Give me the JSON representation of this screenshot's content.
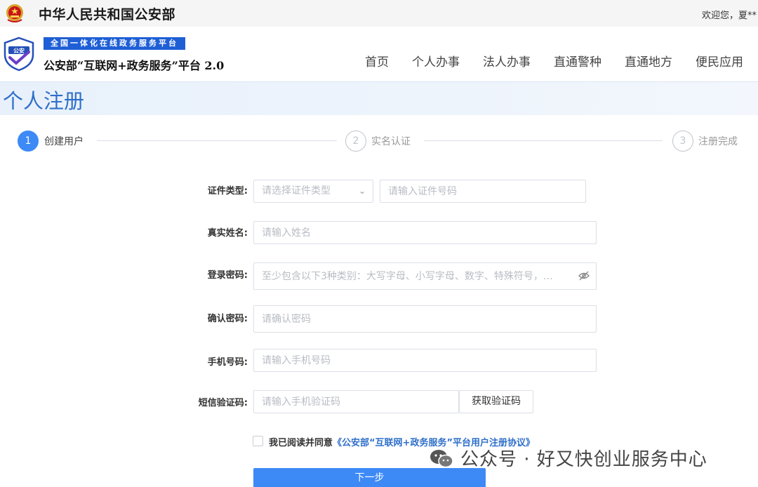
{
  "topbar": {
    "gov_title": "中华人民共和国公安部",
    "welcome": "欢迎您，夏**"
  },
  "header": {
    "logo_badge_text": "公安",
    "slogan": "全国一体化在线政务服务平台",
    "platform_name": "公安部“互联网+政务服务”平台 2.0",
    "nav": [
      "首页",
      "个人办事",
      "法人办事",
      "直通警种",
      "直通地方",
      "便民应用"
    ]
  },
  "page": {
    "title": "个人注册"
  },
  "steps": [
    {
      "number": "1",
      "label": "创建用户",
      "state": "active"
    },
    {
      "number": "2",
      "label": "实名认证",
      "state": "inactive"
    },
    {
      "number": "3",
      "label": "注册完成",
      "state": "inactive"
    }
  ],
  "form": {
    "id_type": {
      "label": "证件类型:",
      "placeholder": "请选择证件类型",
      "value": ""
    },
    "id_number": {
      "placeholder": "请输入证件号码",
      "value": ""
    },
    "real_name": {
      "label": "真实姓名:",
      "placeholder": "请输入姓名",
      "value": ""
    },
    "password": {
      "label": "登录密码:",
      "placeholder": "至少包含以下3种类别：大写字母、小写字母、数字、特殊符号，…",
      "value": ""
    },
    "confirm_password": {
      "label": "确认密码:",
      "placeholder": "请确认密码",
      "value": ""
    },
    "phone": {
      "label": "手机号码:",
      "placeholder": "请输入手机号码",
      "value": ""
    },
    "sms_code": {
      "label": "短信验证码:",
      "placeholder": "请输入手机验证码",
      "value": ""
    },
    "get_code_label": "获取验证码",
    "agreement_prefix": "我已阅读并同意",
    "agreement_link": "《公安部“互联网+政务服务”平台用户注册协议》",
    "agreement_checked": false,
    "next_label": "下一步"
  },
  "watermark": {
    "text": "公众号 · 好又快创业服务中心"
  },
  "colors": {
    "primary": "#3d8af7",
    "title_blue": "#2f6fc9",
    "slogan_bg": "#1e5fd6",
    "border": "#dcdfe6"
  }
}
